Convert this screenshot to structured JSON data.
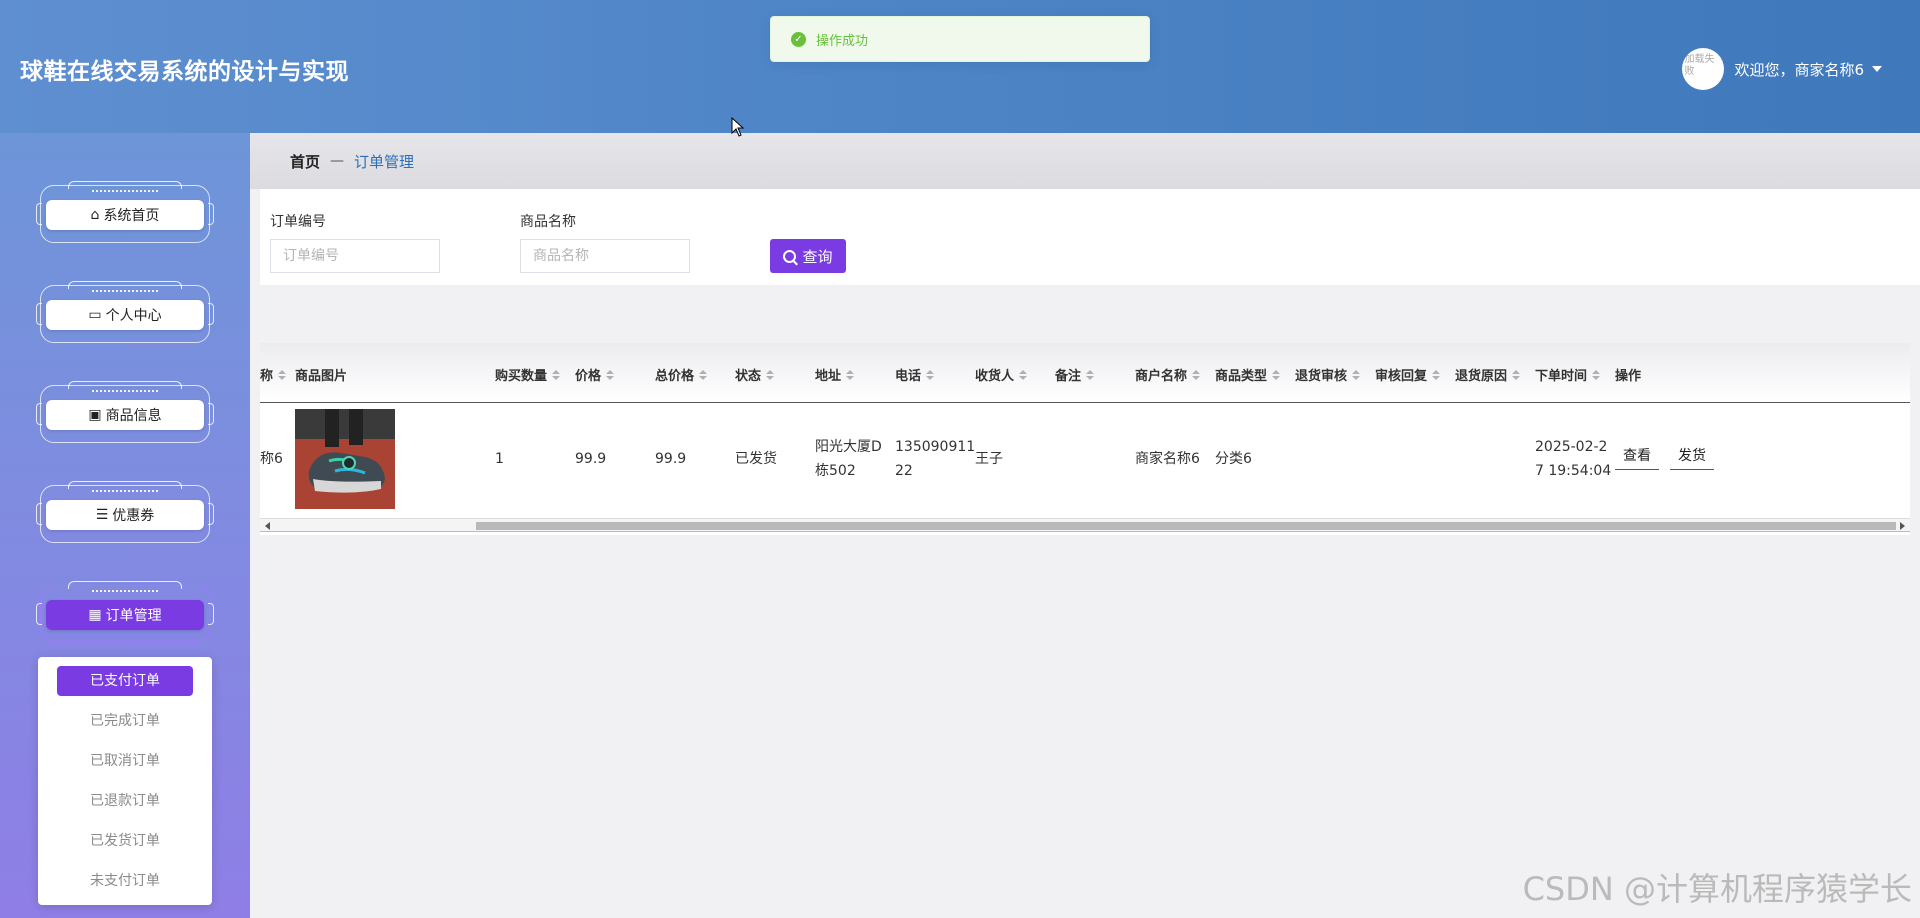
{
  "header": {
    "app_title": "球鞋在线交易系统的设计与实现",
    "avatar_text": "加载失败",
    "welcome": "欢迎您，商家名称6"
  },
  "toast": {
    "message": "操作成功"
  },
  "sidebar": {
    "items": [
      {
        "label": "系统首页",
        "icon": "home-icon"
      },
      {
        "label": "个人中心",
        "icon": "id-card-icon"
      },
      {
        "label": "商品信息",
        "icon": "clipboard-icon"
      },
      {
        "label": "优惠券",
        "icon": "list-icon"
      },
      {
        "label": "订单管理",
        "icon": "grid-icon",
        "active": true
      }
    ],
    "submenu": [
      {
        "label": "已支付订单",
        "active": true
      },
      {
        "label": "已完成订单"
      },
      {
        "label": "已取消订单"
      },
      {
        "label": "已退款订单"
      },
      {
        "label": "已发货订单"
      },
      {
        "label": "未支付订单"
      }
    ]
  },
  "breadcrumb": {
    "home": "首页",
    "separator": "—",
    "current": "订单管理"
  },
  "search": {
    "order_no_label": "订单编号",
    "order_no_placeholder": "订单编号",
    "order_no_value": "",
    "product_name_label": "商品名称",
    "product_name_placeholder": "商品名称",
    "product_name_value": "",
    "query_button": "查询"
  },
  "table": {
    "columns": [
      "称",
      "商品图片",
      "购买数量",
      "价格",
      "总价格",
      "状态",
      "地址",
      "电话",
      "收货人",
      "备注",
      "商户名称",
      "商品类型",
      "退货审核",
      "审核回复",
      "退货原因",
      "下单时间",
      "操作"
    ],
    "rows": [
      {
        "name_fragment": "称6",
        "quantity": "1",
        "price": "99.9",
        "total_price": "99.9",
        "status": "已发货",
        "address": "阳光大厦D栋502",
        "address_line1": "阳光大厦D",
        "address_line2": "栋502",
        "phone_line1": "135090911",
        "phone_line2": "22",
        "receiver": "王子",
        "note": "",
        "merchant": "商家名称6",
        "product_type": "分类6",
        "return_review": "",
        "review_reply": "",
        "return_reason": "",
        "order_time_line1": "2025-02-2",
        "order_time_line2": "7 19:54:04",
        "actions": [
          "查看",
          "发货"
        ]
      }
    ]
  },
  "watermark": "CSDN @计算机程序猿学长",
  "colors": {
    "header_blue": "#4f86c8",
    "accent_purple": "#7a3be2",
    "success_green": "#67c23a",
    "breadcrumb_link": "#2c6fb7"
  }
}
